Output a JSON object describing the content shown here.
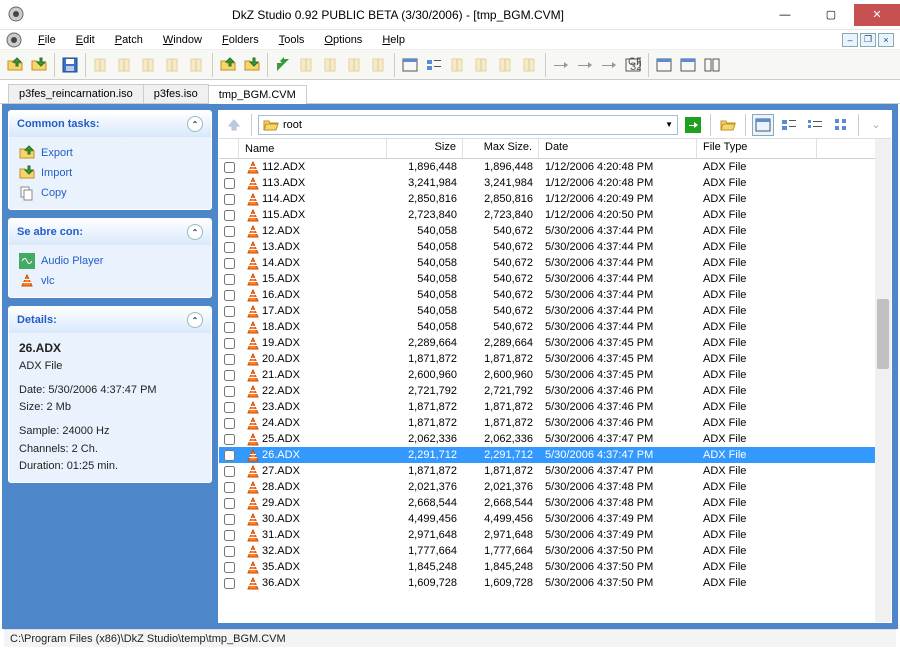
{
  "window": {
    "title": "DkZ Studio 0.92 PUBLIC BETA (3/30/2006)  -  [tmp_BGM.CVM]"
  },
  "menu": [
    "File",
    "Edit",
    "Patch",
    "Window",
    "Folders",
    "Tools",
    "Options",
    "Help"
  ],
  "tabs": [
    {
      "label": "p3fes_reincarnation.iso",
      "active": false
    },
    {
      "label": "p3fes.iso",
      "active": false
    },
    {
      "label": "tmp_BGM.CVM",
      "active": true
    }
  ],
  "sidebar": {
    "common": {
      "title": "Common tasks:",
      "items": [
        {
          "label": "Export",
          "icon": "export-icon"
        },
        {
          "label": "Import",
          "icon": "import-icon"
        },
        {
          "label": "Copy",
          "icon": "copy-icon"
        }
      ]
    },
    "openwith": {
      "title": "Se abre con:",
      "items": [
        {
          "label": "Audio Player"
        },
        {
          "label": "vlc"
        }
      ]
    },
    "details": {
      "title": "Details:",
      "name": "26.ADX",
      "type": "ADX File",
      "date_label": "Date: 5/30/2006 4:37:47 PM",
      "size_label": "Size: 2 Mb",
      "sample": "Sample: 24000 Hz",
      "channels": "Channels: 2 Ch.",
      "duration": "Duration: 01:25 min."
    }
  },
  "pathbar": {
    "root": "root"
  },
  "columns": {
    "name": "Name",
    "size": "Size",
    "max": "Max Size.",
    "date": "Date",
    "type": "File Type"
  },
  "rows": [
    {
      "name": "112.ADX",
      "size": "1,896,448",
      "max": "1,896,448",
      "date": "1/12/2006 4:20:48 PM",
      "type": "ADX File"
    },
    {
      "name": "113.ADX",
      "size": "3,241,984",
      "max": "3,241,984",
      "date": "1/12/2006 4:20:48 PM",
      "type": "ADX File"
    },
    {
      "name": "114.ADX",
      "size": "2,850,816",
      "max": "2,850,816",
      "date": "1/12/2006 4:20:49 PM",
      "type": "ADX File"
    },
    {
      "name": "115.ADX",
      "size": "2,723,840",
      "max": "2,723,840",
      "date": "1/12/2006 4:20:50 PM",
      "type": "ADX File"
    },
    {
      "name": "12.ADX",
      "size": "540,058",
      "max": "540,672",
      "date": "5/30/2006 4:37:44 PM",
      "type": "ADX File"
    },
    {
      "name": "13.ADX",
      "size": "540,058",
      "max": "540,672",
      "date": "5/30/2006 4:37:44 PM",
      "type": "ADX File"
    },
    {
      "name": "14.ADX",
      "size": "540,058",
      "max": "540,672",
      "date": "5/30/2006 4:37:44 PM",
      "type": "ADX File"
    },
    {
      "name": "15.ADX",
      "size": "540,058",
      "max": "540,672",
      "date": "5/30/2006 4:37:44 PM",
      "type": "ADX File"
    },
    {
      "name": "16.ADX",
      "size": "540,058",
      "max": "540,672",
      "date": "5/30/2006 4:37:44 PM",
      "type": "ADX File"
    },
    {
      "name": "17.ADX",
      "size": "540,058",
      "max": "540,672",
      "date": "5/30/2006 4:37:44 PM",
      "type": "ADX File"
    },
    {
      "name": "18.ADX",
      "size": "540,058",
      "max": "540,672",
      "date": "5/30/2006 4:37:44 PM",
      "type": "ADX File"
    },
    {
      "name": "19.ADX",
      "size": "2,289,664",
      "max": "2,289,664",
      "date": "5/30/2006 4:37:45 PM",
      "type": "ADX File"
    },
    {
      "name": "20.ADX",
      "size": "1,871,872",
      "max": "1,871,872",
      "date": "5/30/2006 4:37:45 PM",
      "type": "ADX File"
    },
    {
      "name": "21.ADX",
      "size": "2,600,960",
      "max": "2,600,960",
      "date": "5/30/2006 4:37:45 PM",
      "type": "ADX File"
    },
    {
      "name": "22.ADX",
      "size": "2,721,792",
      "max": "2,721,792",
      "date": "5/30/2006 4:37:46 PM",
      "type": "ADX File"
    },
    {
      "name": "23.ADX",
      "size": "1,871,872",
      "max": "1,871,872",
      "date": "5/30/2006 4:37:46 PM",
      "type": "ADX File"
    },
    {
      "name": "24.ADX",
      "size": "1,871,872",
      "max": "1,871,872",
      "date": "5/30/2006 4:37:46 PM",
      "type": "ADX File"
    },
    {
      "name": "25.ADX",
      "size": "2,062,336",
      "max": "2,062,336",
      "date": "5/30/2006 4:37:47 PM",
      "type": "ADX File"
    },
    {
      "name": "26.ADX",
      "size": "2,291,712",
      "max": "2,291,712",
      "date": "5/30/2006 4:37:47 PM",
      "type": "ADX File",
      "selected": true
    },
    {
      "name": "27.ADX",
      "size": "1,871,872",
      "max": "1,871,872",
      "date": "5/30/2006 4:37:47 PM",
      "type": "ADX File"
    },
    {
      "name": "28.ADX",
      "size": "2,021,376",
      "max": "2,021,376",
      "date": "5/30/2006 4:37:48 PM",
      "type": "ADX File"
    },
    {
      "name": "29.ADX",
      "size": "2,668,544",
      "max": "2,668,544",
      "date": "5/30/2006 4:37:48 PM",
      "type": "ADX File"
    },
    {
      "name": "30.ADX",
      "size": "4,499,456",
      "max": "4,499,456",
      "date": "5/30/2006 4:37:49 PM",
      "type": "ADX File"
    },
    {
      "name": "31.ADX",
      "size": "2,971,648",
      "max": "2,971,648",
      "date": "5/30/2006 4:37:49 PM",
      "type": "ADX File"
    },
    {
      "name": "32.ADX",
      "size": "1,777,664",
      "max": "1,777,664",
      "date": "5/30/2006 4:37:50 PM",
      "type": "ADX File"
    },
    {
      "name": "35.ADX",
      "size": "1,845,248",
      "max": "1,845,248",
      "date": "5/30/2006 4:37:50 PM",
      "type": "ADX File"
    },
    {
      "name": "36.ADX",
      "size": "1,609,728",
      "max": "1,609,728",
      "date": "5/30/2006 4:37:50 PM",
      "type": "ADX File"
    }
  ],
  "statusbar": "C:\\Program Files (x86)\\DkZ Studio\\temp\\tmp_BGM.CVM"
}
